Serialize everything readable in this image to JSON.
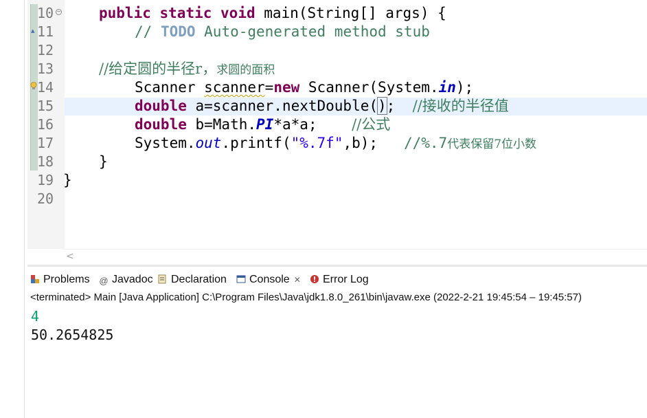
{
  "editor": {
    "line_numbers": [
      "10",
      "11",
      "12",
      "13",
      "14",
      "15",
      "16",
      "17",
      "18",
      "19",
      "20"
    ],
    "lines": {
      "l10": {
        "k1": "public",
        "k2": "static",
        "k3": "void",
        "rest": " main(String[] args) {"
      },
      "l11": {
        "c1": "// ",
        "todo": "TODO",
        "c2": " Auto-generated method stub"
      },
      "l13": {
        "c1": "//给定圆的半径r，",
        "c2": "求圆的面积"
      },
      "l14": {
        "t1": "Scanner ",
        "var": "scanner",
        "t2": "=",
        "kw": "new",
        "t3": " Scanner(System.",
        "fld": "in",
        "t4": ");"
      },
      "l15": {
        "kw": "double",
        "t1": " a=scanner.nextDouble(",
        "paren": ")",
        "t2": ";  ",
        "cm": "//接收的半径值"
      },
      "l16": {
        "kw": "double",
        "t1": " b=Math.",
        "fld": "PI",
        "t2": "*a*a;    ",
        "cm": "//公式"
      },
      "l17": {
        "t1": "System.",
        "fld": "out",
        "t2": ".printf(",
        "st": "\"%.7f\"",
        "t3": ",b);   ",
        "c1": "//%.7",
        "c2": "代表保留",
        "c3": "7",
        "c4": "位小数"
      },
      "l18": {
        "t1": "}"
      },
      "l19": {
        "t1": "}"
      }
    },
    "fold_icon": "minus-fold-icon",
    "scroll_arrow": "<"
  },
  "views": {
    "tabs": [
      {
        "label": "Problems",
        "icon": "problems-icon"
      },
      {
        "label": "Javadoc",
        "icon": "at-icon"
      },
      {
        "label": "Declaration",
        "icon": "declaration-icon"
      },
      {
        "label": "Console",
        "icon": "console-icon"
      },
      {
        "label": "Error Log",
        "icon": "error-log-icon"
      }
    ],
    "close_glyph": "✕"
  },
  "console": {
    "status": "<terminated> Main [Java Application] C:\\Program Files\\Java\\jdk1.8.0_261\\bin\\javaw.exe  (2022-2-21 19:45:54 – 19:45:57)",
    "input_line": "4",
    "output_line": "50.2654825"
  },
  "colors": {
    "keyword": "#7f0055",
    "comment": "#3f7f5f",
    "string": "#2a00ff",
    "field": "#0000c0",
    "console_input": "#00a070",
    "current_line": "#e8f2fe"
  }
}
